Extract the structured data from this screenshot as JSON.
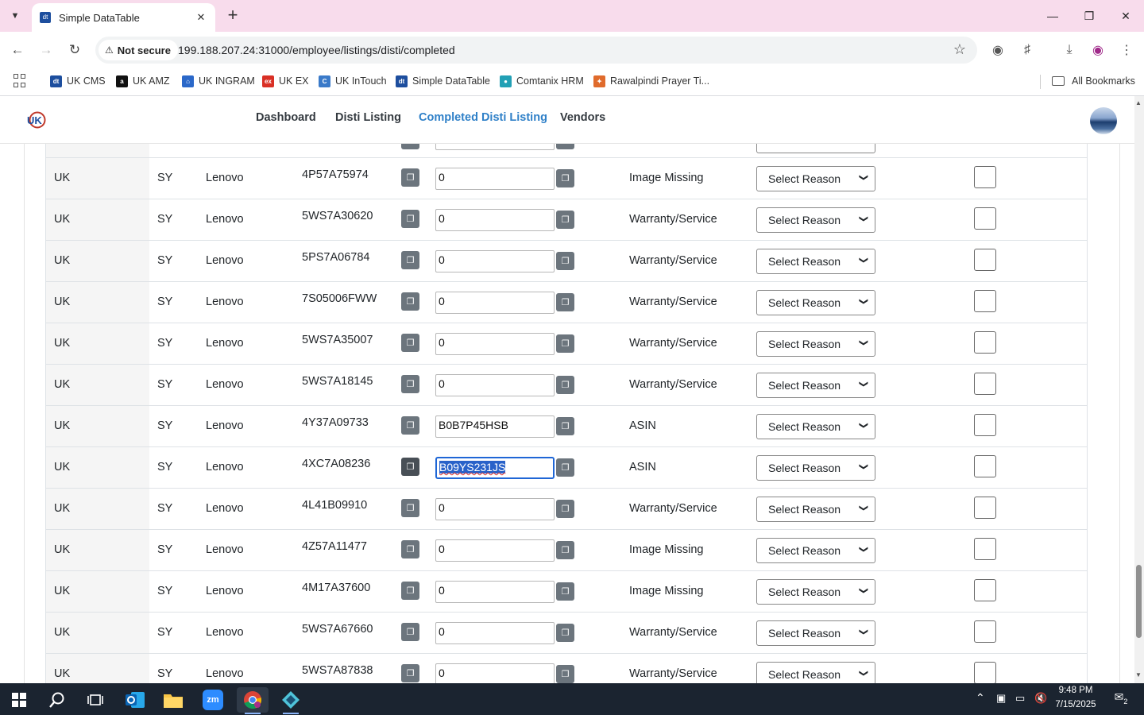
{
  "browser": {
    "tab_title": "Simple DataTable",
    "tab_favicon_text": "dt",
    "security_label": "Not secure",
    "url": "199.188.207.24:31000/employee/listings/disti/completed"
  },
  "bookmarks": [
    {
      "label": "UK CMS",
      "color": "#1d4e9e",
      "glyph": "dt"
    },
    {
      "label": "UK AMZ",
      "color": "#111111",
      "glyph": "a"
    },
    {
      "label": "UK INGRAM",
      "color": "#2b68c9",
      "glyph": "⌂"
    },
    {
      "label": "UK EX",
      "color": "#d93025",
      "glyph": "ex"
    },
    {
      "label": "UK InTouch",
      "color": "#3a7ac9",
      "glyph": "C"
    },
    {
      "label": "Simple DataTable",
      "color": "#1d4e9e",
      "glyph": "dt"
    },
    {
      "label": "Comtanix HRM",
      "color": "#22a0b5",
      "glyph": "●"
    },
    {
      "label": "Rawalpindi Prayer Ti...",
      "color": "#e06b2c",
      "glyph": "✦"
    }
  ],
  "all_bookmarks_label": "All Bookmarks",
  "site_nav": {
    "links": [
      "Dashboard",
      "Disti Listing",
      "Completed Disti Listing",
      "Vendors"
    ],
    "active": "Completed Disti Listing"
  },
  "select_placeholder": "Select Reason",
  "rows": [
    {
      "country": "UK",
      "code": "SY",
      "brand": "Lenovo",
      "part": "4P57A75974",
      "value": "0",
      "status": "Image Missing"
    },
    {
      "country": "UK",
      "code": "SY",
      "brand": "Lenovo",
      "part": "5WS7A30620",
      "value": "0",
      "status": "Warranty/Service"
    },
    {
      "country": "UK",
      "code": "SY",
      "brand": "Lenovo",
      "part": "5PS7A06784",
      "value": "0",
      "status": "Warranty/Service"
    },
    {
      "country": "UK",
      "code": "SY",
      "brand": "Lenovo",
      "part": "7S05006FWW",
      "value": "0",
      "status": "Warranty/Service"
    },
    {
      "country": "UK",
      "code": "SY",
      "brand": "Lenovo",
      "part": "5WS7A35007",
      "value": "0",
      "status": "Warranty/Service"
    },
    {
      "country": "UK",
      "code": "SY",
      "brand": "Lenovo",
      "part": "5WS7A18145",
      "value": "0",
      "status": "Warranty/Service"
    },
    {
      "country": "UK",
      "code": "SY",
      "brand": "Lenovo",
      "part": "4Y37A09733",
      "value": "B0B7P45HSB",
      "status": "ASIN"
    },
    {
      "country": "UK",
      "code": "SY",
      "brand": "Lenovo",
      "part": "4XC7A08236",
      "value": "B09YS231JS",
      "status": "ASIN",
      "focused": true
    },
    {
      "country": "UK",
      "code": "SY",
      "brand": "Lenovo",
      "part": "4L41B09910",
      "value": "0",
      "status": "Warranty/Service"
    },
    {
      "country": "UK",
      "code": "SY",
      "brand": "Lenovo",
      "part": "4Z57A11477",
      "value": "0",
      "status": "Image Missing"
    },
    {
      "country": "UK",
      "code": "SY",
      "brand": "Lenovo",
      "part": "4M17A37600",
      "value": "0",
      "status": "Image Missing"
    },
    {
      "country": "UK",
      "code": "SY",
      "brand": "Lenovo",
      "part": "5WS7A67660",
      "value": "0",
      "status": "Warranty/Service"
    },
    {
      "country": "UK",
      "code": "SY",
      "brand": "Lenovo",
      "part": "5WS7A87838",
      "value": "0",
      "status": "Warranty/Service"
    }
  ],
  "taskbar": {
    "time": "9:48 PM",
    "date": "7/15/2025",
    "notification_count": "2",
    "zoom_label": "zm"
  },
  "colors": {
    "tabstrip": "#f8dcec",
    "active_link": "#2f80c8",
    "copy_button": "#6c757d",
    "taskbar": "#1b2430"
  }
}
